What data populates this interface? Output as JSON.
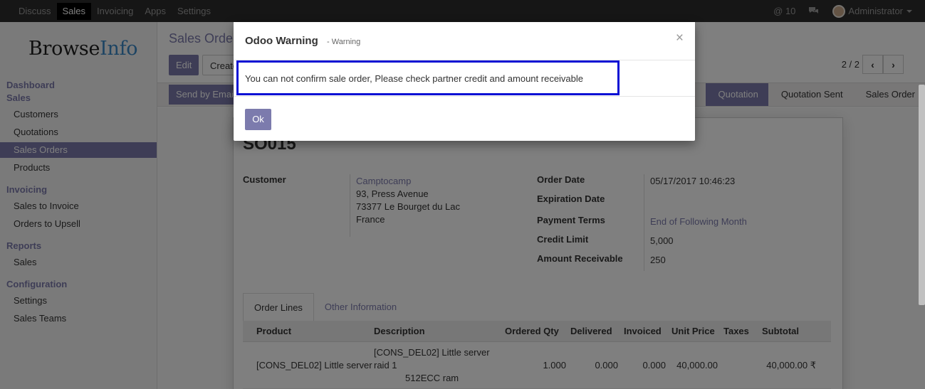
{
  "topbar": {
    "menu": [
      "Discuss",
      "Sales",
      "Invoicing",
      "Apps",
      "Settings"
    ],
    "mentions_count": "@ 10",
    "user_name": "Administrator"
  },
  "sidebar": {
    "logo_dark": "Browse",
    "logo_blue": "Info",
    "sections": [
      {
        "heading": "Dashboard"
      },
      {
        "heading": "Sales",
        "items": [
          "Customers",
          "Quotations",
          "Sales Orders",
          "Products"
        ]
      },
      {
        "heading": "Invoicing",
        "items": [
          "Sales to Invoice",
          "Orders to Upsell"
        ]
      },
      {
        "heading": "Reports",
        "items": [
          "Sales"
        ]
      },
      {
        "heading": "Configuration",
        "items": [
          "Settings",
          "Sales Teams"
        ]
      }
    ]
  },
  "main": {
    "breadcrumb": "Sales Orders",
    "edit_label": "Edit",
    "create_label": "Create",
    "pager": "2 / 2",
    "send_email_label": "Send by Email",
    "stages": [
      "Quotation",
      "Quotation Sent",
      "Sales Order"
    ],
    "order_name": "SO015",
    "customer_label": "Customer",
    "customer_name": "Camptocamp",
    "address_line1": "93, Press Avenue",
    "address_line2": "73377 Le Bourget du Lac",
    "address_line3": "France",
    "order_date_label": "Order Date",
    "order_date": "05/17/2017 10:46:23",
    "expiration_date_label": "Expiration Date",
    "payment_terms_label": "Payment Terms",
    "payment_terms": "End of Following Month",
    "credit_limit_label": "Credit Limit",
    "credit_limit": "5,000",
    "amount_receivable_label": "Amount Receivable",
    "amount_receivable": "250",
    "tabs": [
      "Order Lines",
      "Other Information"
    ],
    "table_headers": [
      "Product",
      "Description",
      "Ordered Qty",
      "Delivered",
      "Invoiced",
      "Unit Price",
      "Taxes",
      "Subtotal"
    ],
    "row": {
      "product": "[CONS_DEL02] Little server",
      "description_line1": "[CONS_DEL02] Little server",
      "description_line2": "raid 1",
      "description_line3": "512ECC ram",
      "ordered_qty": "1.000",
      "delivered": "0.000",
      "invoiced": "0.000",
      "unit_price": "40,000.00",
      "taxes": "",
      "subtotal": "40,000.00 ₹"
    }
  },
  "modal": {
    "title": "Odoo Warning",
    "subtitle": "- Warning",
    "close": "×",
    "message": "You can not confirm sale order, Please check partner credit and amount receivable",
    "ok_label": "Ok"
  },
  "colors": {
    "accent": "#7c7bad",
    "highlight_border": "#0a11d4",
    "topbar": "#2c2c2c"
  }
}
